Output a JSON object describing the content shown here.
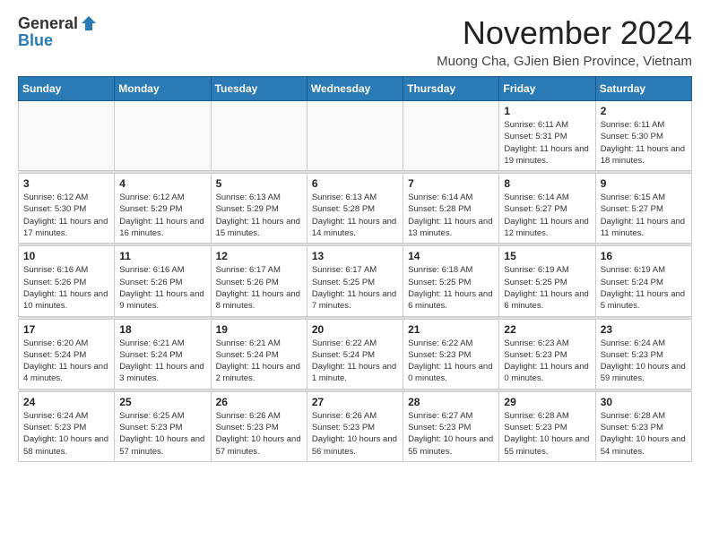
{
  "header": {
    "logo_general": "General",
    "logo_blue": "Blue",
    "month_title": "November 2024",
    "location": "Muong Cha, GJien Bien Province, Vietnam"
  },
  "days_of_week": [
    "Sunday",
    "Monday",
    "Tuesday",
    "Wednesday",
    "Thursday",
    "Friday",
    "Saturday"
  ],
  "weeks": [
    {
      "days": [
        {
          "num": "",
          "info": ""
        },
        {
          "num": "",
          "info": ""
        },
        {
          "num": "",
          "info": ""
        },
        {
          "num": "",
          "info": ""
        },
        {
          "num": "",
          "info": ""
        },
        {
          "num": "1",
          "info": "Sunrise: 6:11 AM\nSunset: 5:31 PM\nDaylight: 11 hours and 19 minutes."
        },
        {
          "num": "2",
          "info": "Sunrise: 6:11 AM\nSunset: 5:30 PM\nDaylight: 11 hours and 18 minutes."
        }
      ]
    },
    {
      "days": [
        {
          "num": "3",
          "info": "Sunrise: 6:12 AM\nSunset: 5:30 PM\nDaylight: 11 hours and 17 minutes."
        },
        {
          "num": "4",
          "info": "Sunrise: 6:12 AM\nSunset: 5:29 PM\nDaylight: 11 hours and 16 minutes."
        },
        {
          "num": "5",
          "info": "Sunrise: 6:13 AM\nSunset: 5:29 PM\nDaylight: 11 hours and 15 minutes."
        },
        {
          "num": "6",
          "info": "Sunrise: 6:13 AM\nSunset: 5:28 PM\nDaylight: 11 hours and 14 minutes."
        },
        {
          "num": "7",
          "info": "Sunrise: 6:14 AM\nSunset: 5:28 PM\nDaylight: 11 hours and 13 minutes."
        },
        {
          "num": "8",
          "info": "Sunrise: 6:14 AM\nSunset: 5:27 PM\nDaylight: 11 hours and 12 minutes."
        },
        {
          "num": "9",
          "info": "Sunrise: 6:15 AM\nSunset: 5:27 PM\nDaylight: 11 hours and 11 minutes."
        }
      ]
    },
    {
      "days": [
        {
          "num": "10",
          "info": "Sunrise: 6:16 AM\nSunset: 5:26 PM\nDaylight: 11 hours and 10 minutes."
        },
        {
          "num": "11",
          "info": "Sunrise: 6:16 AM\nSunset: 5:26 PM\nDaylight: 11 hours and 9 minutes."
        },
        {
          "num": "12",
          "info": "Sunrise: 6:17 AM\nSunset: 5:26 PM\nDaylight: 11 hours and 8 minutes."
        },
        {
          "num": "13",
          "info": "Sunrise: 6:17 AM\nSunset: 5:25 PM\nDaylight: 11 hours and 7 minutes."
        },
        {
          "num": "14",
          "info": "Sunrise: 6:18 AM\nSunset: 5:25 PM\nDaylight: 11 hours and 6 minutes."
        },
        {
          "num": "15",
          "info": "Sunrise: 6:19 AM\nSunset: 5:25 PM\nDaylight: 11 hours and 6 minutes."
        },
        {
          "num": "16",
          "info": "Sunrise: 6:19 AM\nSunset: 5:24 PM\nDaylight: 11 hours and 5 minutes."
        }
      ]
    },
    {
      "days": [
        {
          "num": "17",
          "info": "Sunrise: 6:20 AM\nSunset: 5:24 PM\nDaylight: 11 hours and 4 minutes."
        },
        {
          "num": "18",
          "info": "Sunrise: 6:21 AM\nSunset: 5:24 PM\nDaylight: 11 hours and 3 minutes."
        },
        {
          "num": "19",
          "info": "Sunrise: 6:21 AM\nSunset: 5:24 PM\nDaylight: 11 hours and 2 minutes."
        },
        {
          "num": "20",
          "info": "Sunrise: 6:22 AM\nSunset: 5:24 PM\nDaylight: 11 hours and 1 minute."
        },
        {
          "num": "21",
          "info": "Sunrise: 6:22 AM\nSunset: 5:23 PM\nDaylight: 11 hours and 0 minutes."
        },
        {
          "num": "22",
          "info": "Sunrise: 6:23 AM\nSunset: 5:23 PM\nDaylight: 11 hours and 0 minutes."
        },
        {
          "num": "23",
          "info": "Sunrise: 6:24 AM\nSunset: 5:23 PM\nDaylight: 10 hours and 59 minutes."
        }
      ]
    },
    {
      "days": [
        {
          "num": "24",
          "info": "Sunrise: 6:24 AM\nSunset: 5:23 PM\nDaylight: 10 hours and 58 minutes."
        },
        {
          "num": "25",
          "info": "Sunrise: 6:25 AM\nSunset: 5:23 PM\nDaylight: 10 hours and 57 minutes."
        },
        {
          "num": "26",
          "info": "Sunrise: 6:26 AM\nSunset: 5:23 PM\nDaylight: 10 hours and 57 minutes."
        },
        {
          "num": "27",
          "info": "Sunrise: 6:26 AM\nSunset: 5:23 PM\nDaylight: 10 hours and 56 minutes."
        },
        {
          "num": "28",
          "info": "Sunrise: 6:27 AM\nSunset: 5:23 PM\nDaylight: 10 hours and 55 minutes."
        },
        {
          "num": "29",
          "info": "Sunrise: 6:28 AM\nSunset: 5:23 PM\nDaylight: 10 hours and 55 minutes."
        },
        {
          "num": "30",
          "info": "Sunrise: 6:28 AM\nSunset: 5:23 PM\nDaylight: 10 hours and 54 minutes."
        }
      ]
    }
  ]
}
